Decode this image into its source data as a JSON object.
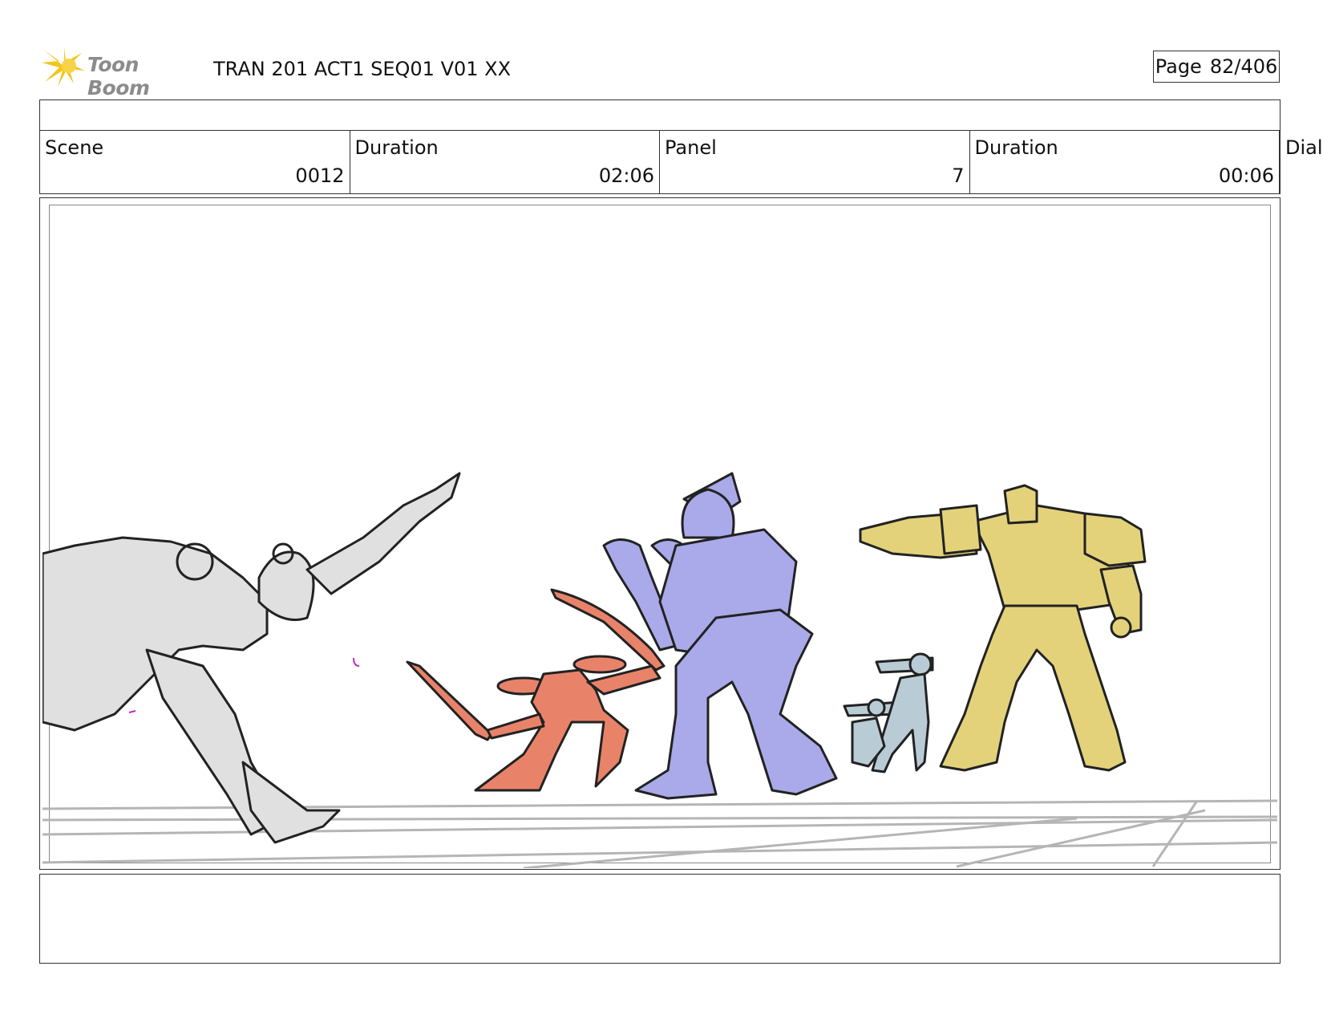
{
  "header": {
    "logo_text": "Toon Boom",
    "title": "TRAN 201 ACT1 SEQ01 V01 XX",
    "page_label": "Page",
    "page_value": "82/406"
  },
  "info": {
    "scene_label": "Scene",
    "scene_value": "0012",
    "scene_duration_label": "Duration",
    "scene_duration_value": "02:06",
    "panel_label": "Panel",
    "panel_value": "7",
    "panel_duration_label": "Duration",
    "panel_duration_value": "00:06",
    "dialog_label": "Dialo"
  },
  "colors": {
    "logo_yellow": "#f5c518",
    "gray_figure": "#e0e0e0",
    "red_figure": "#e8836a",
    "purple_figure": "#aaa9ea",
    "blue_figure": "#b9ccd6",
    "yellow_figure": "#e3d27a",
    "floor_lines": "#b5b5b5"
  },
  "panel_art": {
    "icon": "storyboard-sketch-robots"
  }
}
